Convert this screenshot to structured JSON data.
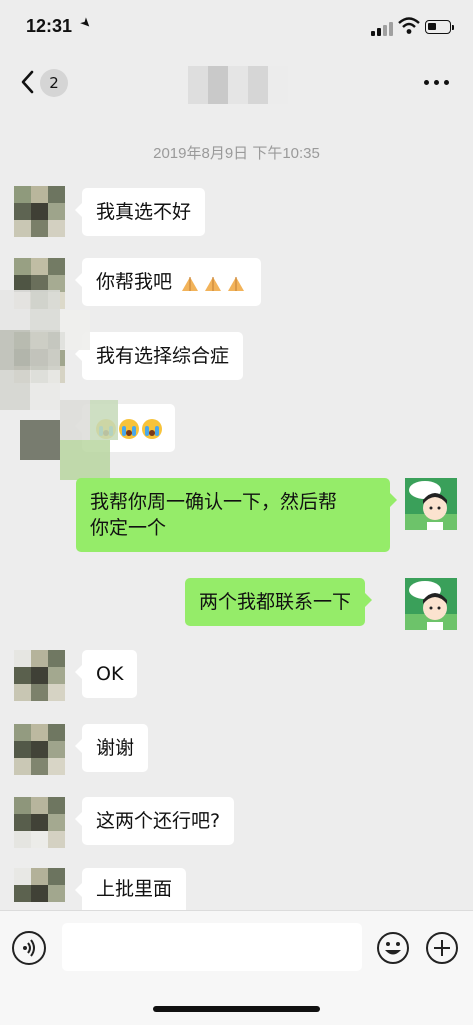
{
  "status_bar": {
    "time": "12:31"
  },
  "nav": {
    "unread_count": "2",
    "title": ""
  },
  "chat": {
    "timestamp": "2019年8月9日 下午10:35",
    "messages": [
      {
        "side": "in",
        "text": "我真选不好"
      },
      {
        "side": "in",
        "text": "你帮我吧",
        "emoji": [
          "folded-hands",
          "folded-hands",
          "folded-hands"
        ]
      },
      {
        "side": "in",
        "text": "我有选择综合症"
      },
      {
        "side": "in",
        "text": "",
        "emoji": [
          "crying-face",
          "crying-face",
          "crying-face"
        ]
      },
      {
        "side": "out",
        "text": "我帮你周一确认一下，然后帮你定一个",
        "line1": "我帮你周一确认一下，然后帮",
        "line2": "你定一个"
      },
      {
        "side": "out",
        "text": "两个我都联系一下"
      },
      {
        "side": "in",
        "text": "OK"
      },
      {
        "side": "in",
        "text": "谢谢"
      },
      {
        "side": "in",
        "text": "这两个还行吧?"
      },
      {
        "side": "in",
        "text": "上批里面"
      }
    ]
  },
  "input_bar": {
    "value": "",
    "placeholder": ""
  },
  "colors": {
    "background": "#ededed",
    "outgoing_bubble": "#95ec69",
    "incoming_bubble": "#ffffff"
  },
  "icons": [
    "back-chevron-icon",
    "more-dots-icon",
    "voice-icon",
    "emoji-icon",
    "plus-icon"
  ]
}
